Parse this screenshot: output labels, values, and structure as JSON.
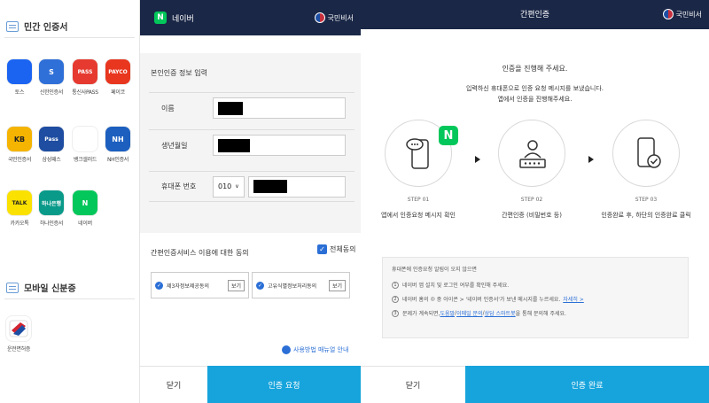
{
  "left": {
    "private_title": "민간 인증서",
    "providers": [
      {
        "name": "토스",
        "logo": "",
        "bg": "#1b64f2",
        "icon": "toss-icon"
      },
      {
        "name": "신한인증서",
        "logo": "S",
        "bg": "#2f6fd8",
        "icon": "shinhan-icon"
      },
      {
        "name": "통신사PASS",
        "logo": "PASS",
        "bg": "#e63a30",
        "icon": "pass-icon"
      },
      {
        "name": "페이코",
        "logo": "PAYCO",
        "bg": "#e8361f",
        "icon": "payco-icon"
      },
      {
        "name": "국민인증서",
        "logo": "KB",
        "bg": "#f4b400",
        "icon": "kb-icon"
      },
      {
        "name": "삼성패스",
        "logo": "Pass",
        "bg": "#1e4da1",
        "icon": "samsung-pass-icon"
      },
      {
        "name": "뱅크샐러드",
        "logo": "",
        "bg": "#ffffff",
        "icon": "banksalad-icon"
      },
      {
        "name": "NH인증서",
        "logo": "NH",
        "bg": "#1c5fbf",
        "icon": "nh-icon"
      },
      {
        "name": "카카오톡",
        "logo": "TALK",
        "bg": "#fae100",
        "icon": "kakaotalk-icon"
      },
      {
        "name": "하나인증서",
        "logo": "하나은행",
        "bg": "#0a9a8a",
        "icon": "hana-icon"
      },
      {
        "name": "네이버",
        "logo": "N",
        "bg": "#03c75a",
        "icon": "naver-icon"
      }
    ],
    "mobile_title": "모바일 신분증",
    "mobile_items": [
      {
        "name": "운전면허증",
        "icon": "drivers-license-icon"
      }
    ]
  },
  "mid": {
    "header_title": "네이버",
    "header_logo": "N",
    "gov_label": "국민비서",
    "form_title": "본인인증 정보 입력",
    "name_label": "이름",
    "birth_label": "생년월일",
    "phone_label": "휴대폰 번호",
    "phone_prefix": "010",
    "consent_title": "간편인증서비스 이용에 대한 동의",
    "all_agree": "전체동의",
    "agree1": "제3자정보제공동의",
    "agree2": "고유식별정보처리동의",
    "view_label": "보기",
    "manual": "사용방법 매뉴얼 안내",
    "close": "닫기",
    "request": "인증 요청"
  },
  "right": {
    "title": "간편인증",
    "gov_label": "국민비서",
    "intro1": "인증을 진행해 주세요.",
    "intro2": "입력하신 휴대폰으로 인증 요청 메시지를 보냈습니다.",
    "intro3": "앱에서 인증을 진행해주세요.",
    "steps": [
      {
        "label": "STEP 01",
        "desc": "앱에서 인증요청 메시지 확인"
      },
      {
        "label": "STEP 02",
        "desc": "간편인증 (비밀번호 등)"
      },
      {
        "label": "STEP 03",
        "desc": "인증완료 후, 하단의 인증완료 클릭"
      }
    ],
    "notice_title": "휴대폰에 인증요청 알림이 오지 않으면",
    "notice1": "네이버 앱 설치 및 로그인 여부를 확인해 주세요.",
    "notice2_a": "네이버 홈의 ",
    "notice2_b": " 중 아이콘 > '네이버 인증서'가 보낸 메시지를 누르세요.",
    "notice2_link": "자세히 >",
    "notice3_a": "문제가 계속되면, ",
    "notice3_l1": "도움말",
    "notice3_l2": "이메일 문의",
    "notice3_l3": "상담 스마트봇",
    "notice3_b": " 을 통해 문의해 주세요.",
    "close": "닫기",
    "complete": "인증 완료"
  }
}
